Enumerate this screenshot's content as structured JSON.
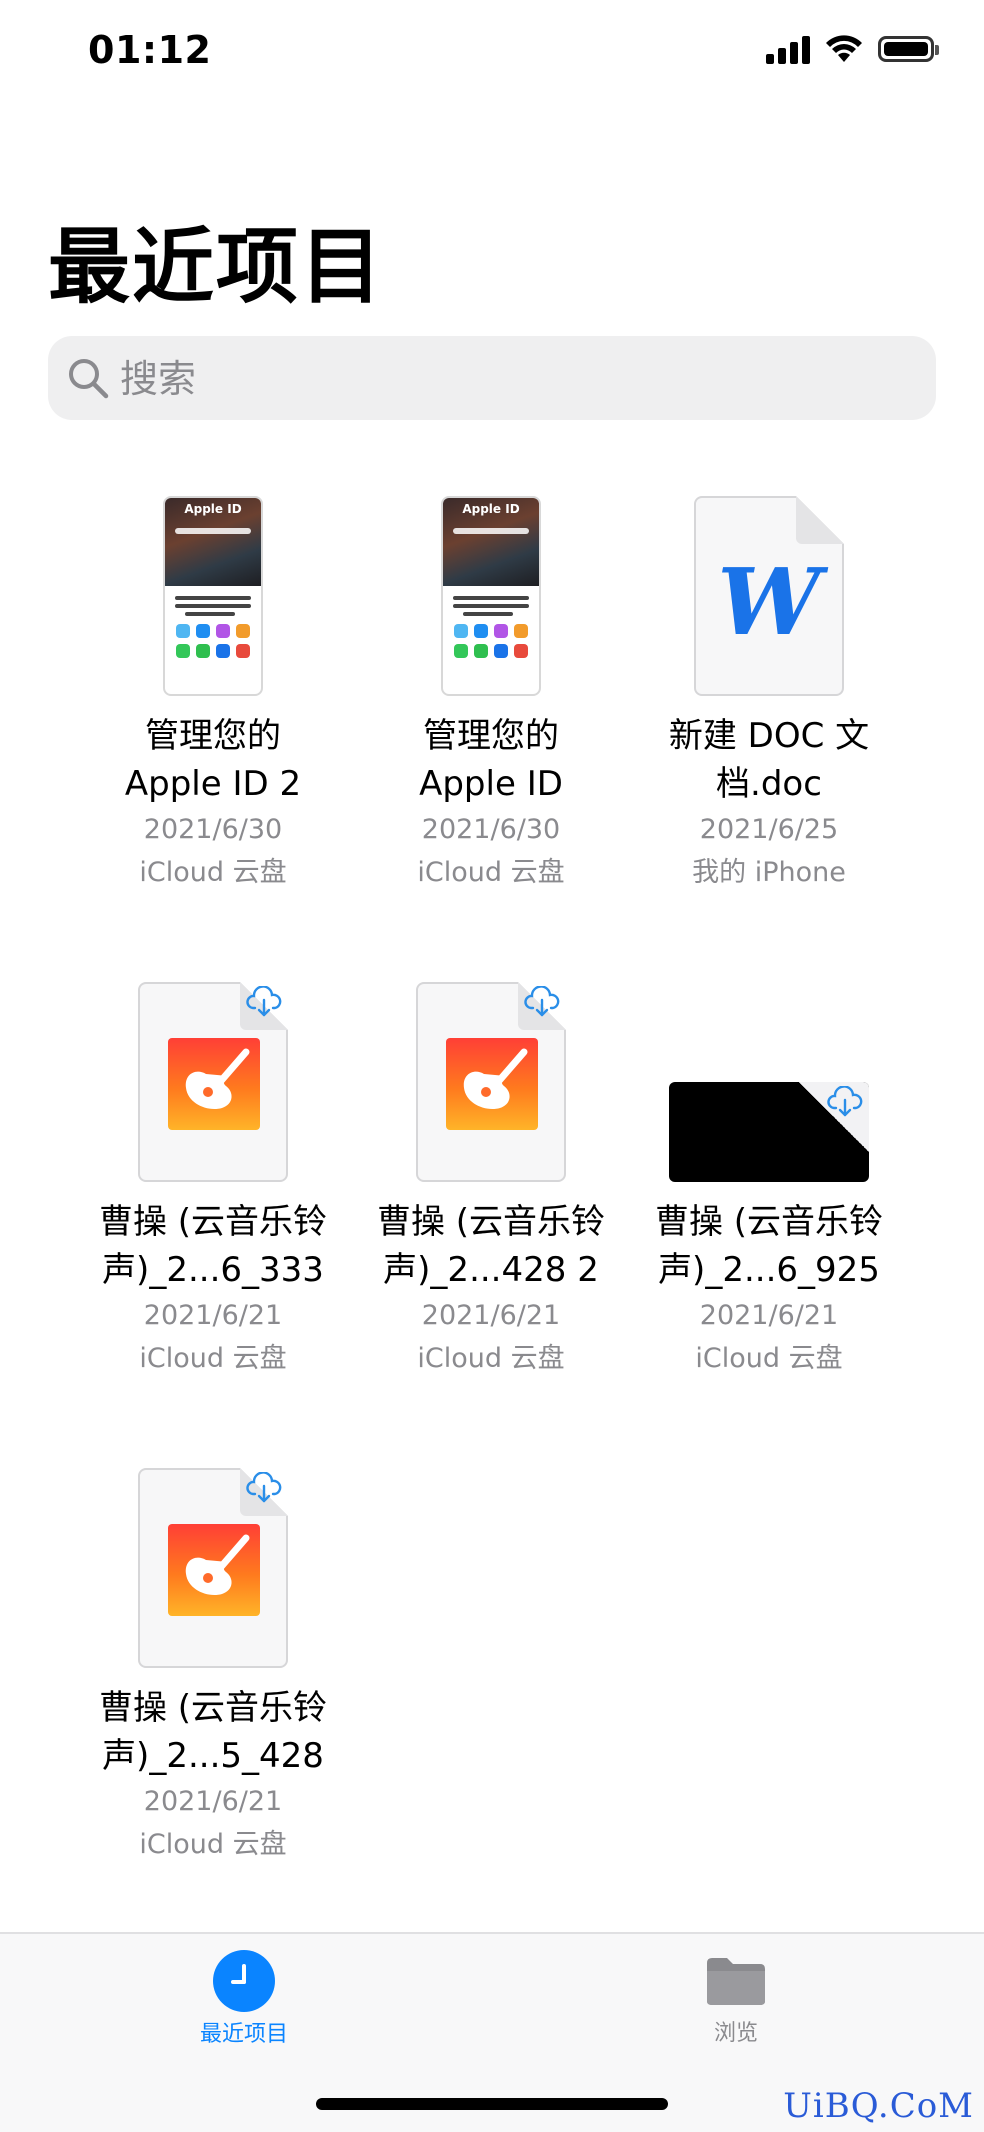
{
  "status_bar": {
    "time": "01:12"
  },
  "page": {
    "title": "最近项目"
  },
  "search": {
    "placeholder": "搜索"
  },
  "files": [
    {
      "name": "管理您的\nApple ID 2",
      "date": "2021/6/30",
      "location": "iCloud 云盘",
      "thumbnail": "apple-id-screenshot",
      "header_text": "Apple ID"
    },
    {
      "name": "管理您的\nApple ID",
      "date": "2021/6/30",
      "location": "iCloud 云盘",
      "thumbnail": "apple-id-screenshot",
      "header_text": "Apple ID"
    },
    {
      "name": "新建 DOC 文\n档.doc",
      "date": "2021/6/25",
      "location": "我的 iPhone",
      "thumbnail": "word-document",
      "icon_letter": "W"
    },
    {
      "name": "曹操 (云音乐铃\n声)_2...6_333",
      "date": "2021/6/21",
      "location": "iCloud 云盘",
      "thumbnail": "garageband-file",
      "icon": "cloud-download-icon"
    },
    {
      "name": "曹操 (云音乐铃\n声)_2...428 2",
      "date": "2021/6/21",
      "location": "iCloud 云盘",
      "thumbnail": "garageband-file",
      "icon": "cloud-download-icon"
    },
    {
      "name": "曹操 (云音乐铃\n声)_2...6_925",
      "date": "2021/6/21",
      "location": "iCloud 云盘",
      "thumbnail": "video-file",
      "icon": "cloud-download-icon"
    },
    {
      "name": "曹操 (云音乐铃\n声)_2...5_428",
      "date": "2021/6/21",
      "location": "iCloud 云盘",
      "thumbnail": "garageband-file",
      "icon": "cloud-download-icon"
    }
  ],
  "tabs": [
    {
      "label": "最近项目",
      "icon": "clock-icon",
      "selected": true
    },
    {
      "label": "浏览",
      "icon": "folder-icon",
      "selected": false
    }
  ],
  "colors": {
    "accent": "#0a84ff",
    "secondary_text": "#8a8a8e",
    "search_background": "#efeff0"
  },
  "watermark": "UiBQ.CoM"
}
